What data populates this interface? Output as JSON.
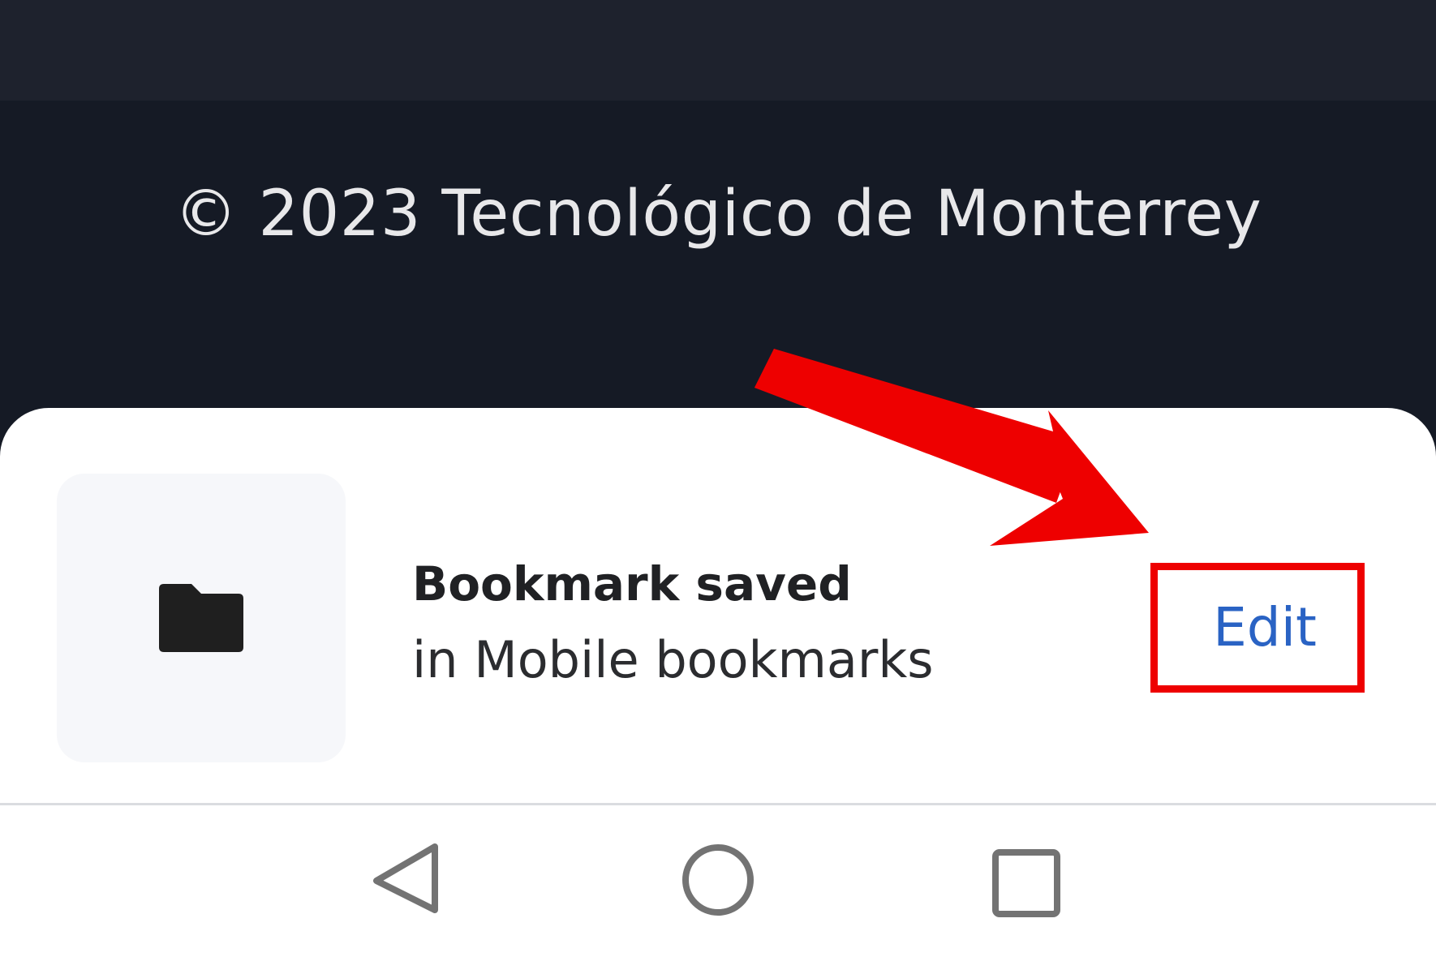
{
  "page": {
    "copyright": "© 2023 Tecnológico de Monterrey"
  },
  "snackbar": {
    "icon": "folder-icon",
    "title": "Bookmark saved",
    "subtitle": "in Mobile bookmarks",
    "action_label": "Edit"
  },
  "annotation": {
    "color": "#ee0000",
    "target": "Edit"
  },
  "nav_bar": {
    "items": [
      "back-icon",
      "home-icon",
      "recents-icon"
    ]
  },
  "colors": {
    "page_background": "#151a25",
    "top_band": "#1e222d",
    "sheet_background": "#ffffff",
    "action_text": "#2a63c4"
  }
}
